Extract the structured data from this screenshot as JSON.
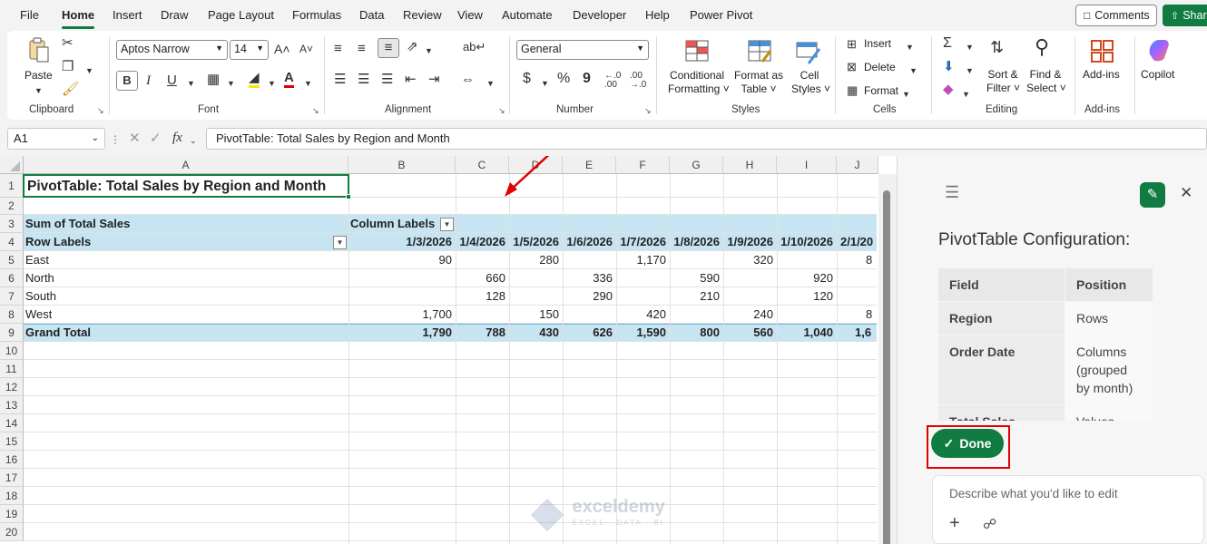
{
  "menu": {
    "tabs": [
      "File",
      "Home",
      "Insert",
      "Draw",
      "Page Layout",
      "Formulas",
      "Data",
      "Review",
      "View",
      "Automate",
      "Developer",
      "Help",
      "Power Pivot"
    ],
    "comments_label": "Comments",
    "share_label": "Shar"
  },
  "ribbon": {
    "clipboard": {
      "label": "Clipboard",
      "paste": "Paste"
    },
    "font": {
      "label": "Font",
      "name": "Aptos Narrow",
      "size": "14",
      "bold": "B",
      "italic": "I",
      "underline": "U",
      "grow": "A˄",
      "shrink": "A˅"
    },
    "alignment": {
      "label": "Alignment"
    },
    "number": {
      "label": "Number",
      "format": "General",
      "currency": "$",
      "percent": "%",
      "comma": "9"
    },
    "styles": {
      "label": "Styles",
      "conditional": [
        "Conditional",
        "Formatting"
      ],
      "format_table": [
        "Format as",
        "Table"
      ],
      "cell_styles": [
        "Cell",
        "Styles"
      ]
    },
    "cells": {
      "label": "Cells",
      "insert": "Insert",
      "delete": "Delete",
      "format": "Format"
    },
    "editing": {
      "label": "Editing",
      "sort": [
        "Sort &",
        "Filter"
      ],
      "find": [
        "Find &",
        "Select"
      ]
    },
    "addins": {
      "label": "Add-ins",
      "button": "Add-ins"
    },
    "copilot": {
      "button": "Copilot"
    }
  },
  "formula_bar": {
    "name_box": "A1",
    "fx": "fx",
    "formula": "PivotTable: Total Sales by Region and Month"
  },
  "sheet": {
    "columns": [
      "A",
      "B",
      "C",
      "D",
      "E",
      "F",
      "G",
      "H",
      "I",
      "J"
    ],
    "rows": [
      "1",
      "2",
      "3",
      "4",
      "5",
      "6",
      "7",
      "8",
      "9",
      "10",
      "11",
      "12",
      "13",
      "14",
      "15",
      "16",
      "17",
      "18",
      "19",
      "20"
    ],
    "title": "PivotTable: Total Sales by Region and Month",
    "sum_label": "Sum of Total Sales",
    "column_labels": "Column Labels",
    "row_labels": "Row Labels",
    "dates": [
      "1/3/2026",
      "1/4/2026",
      "1/5/2026",
      "1/6/2026",
      "1/7/2026",
      "1/8/2026",
      "1/9/2026",
      "1/10/2026",
      "2/1/20"
    ],
    "regions": [
      {
        "name": "East",
        "values": [
          "90",
          "",
          "280",
          "",
          "1,170",
          "",
          "320",
          "",
          "8"
        ]
      },
      {
        "name": "North",
        "values": [
          "",
          "660",
          "",
          "336",
          "",
          "590",
          "",
          "920",
          ""
        ]
      },
      {
        "name": "South",
        "values": [
          "",
          "128",
          "",
          "290",
          "",
          "210",
          "",
          "120",
          ""
        ]
      },
      {
        "name": "West",
        "values": [
          "1,700",
          "",
          "150",
          "",
          "420",
          "",
          "240",
          "",
          "8"
        ]
      }
    ],
    "grand_total": {
      "name": "Grand Total",
      "values": [
        "1,790",
        "788",
        "430",
        "626",
        "1,590",
        "800",
        "560",
        "1,040",
        "1,6"
      ]
    },
    "watermark": {
      "name": "exceldemy",
      "tagline": "EXCEL · DATA · BI"
    }
  },
  "pane": {
    "title": "PivotTable Configuration:",
    "table": {
      "headers": [
        "Field",
        "Position"
      ],
      "rows": [
        {
          "field": "Region",
          "position": "Rows"
        },
        {
          "field": "Order Date",
          "position": "Columns (grouped by month)"
        },
        {
          "field": "Total Sales",
          "position": "Values (Sum)"
        }
      ]
    },
    "done_label": "Done",
    "prompt_placeholder": "Describe what you'd like to edit"
  },
  "colors": {
    "accent": "#107c41",
    "pivot_band": "#c6e4f2",
    "highlight": "#e00000"
  }
}
